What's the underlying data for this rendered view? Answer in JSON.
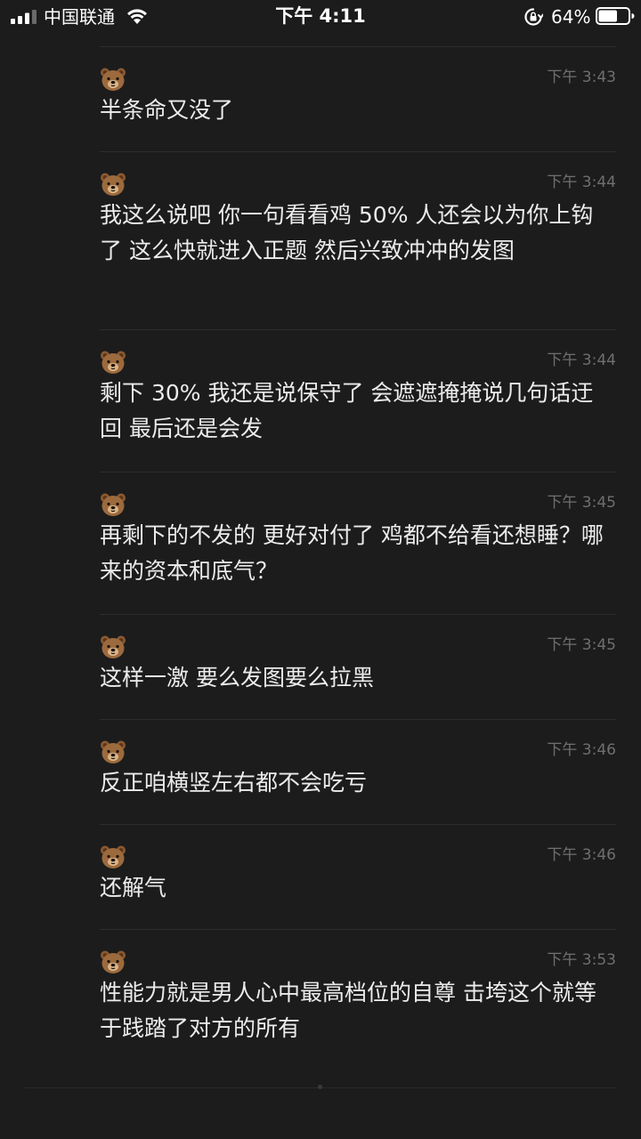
{
  "status_bar": {
    "carrier": "中国联通",
    "time": "下午 4:11",
    "battery_percent": "64%",
    "battery_level": 0.64,
    "signal_bars": 3,
    "icons": [
      "signal-icon",
      "wifi-icon",
      "orientation-lock-icon",
      "battery-icon"
    ]
  },
  "messages": [
    {
      "avatar": "bear-face-icon",
      "time": "下午 3:43",
      "text": "半条命又没了"
    },
    {
      "avatar": "bear-face-icon",
      "time": "下午 3:44",
      "text": "我这么说吧 你一句看看鸡 50% 人还会以为你上钩了 这么快就进入正题 然后兴致冲冲的发图"
    },
    {
      "avatar": "bear-face-icon",
      "time": "下午 3:44",
      "text": "剩下 30% 我还是说保守了 会遮遮掩掩说几句话迂回 最后还是会发"
    },
    {
      "avatar": "bear-face-icon",
      "time": "下午 3:45",
      "text": "再剩下的不发的 更好对付了 鸡都不给看还想睡？哪来的资本和底气？"
    },
    {
      "avatar": "bear-face-icon",
      "time": "下午 3:45",
      "text": "这样一激 要么发图要么拉黑"
    },
    {
      "avatar": "bear-face-icon",
      "time": "下午 3:46",
      "text": "反正咱横竖左右都不会吃亏"
    },
    {
      "avatar": "bear-face-icon",
      "time": "下午 3:46",
      "text": "还解气"
    },
    {
      "avatar": "bear-face-icon",
      "time": "下午 3:53",
      "text": "性能力就是男人心中最高档位的自尊 击垮这个就等于践踏了对方的所有"
    }
  ]
}
